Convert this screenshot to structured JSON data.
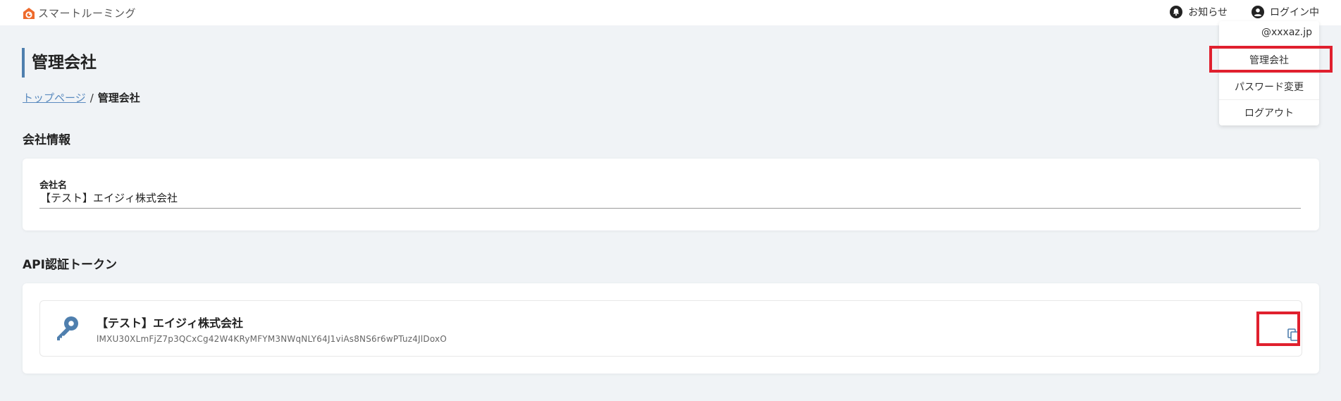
{
  "header": {
    "app_name": "スマートルーミング",
    "notifications_label": "お知らせ",
    "login_status_label": "ログイン中"
  },
  "user_menu": {
    "email": "@xxxaz.jp",
    "items": [
      {
        "label": "管理会社"
      },
      {
        "label": "パスワード変更"
      },
      {
        "label": "ログアウト"
      }
    ]
  },
  "page": {
    "title": "管理会社",
    "breadcrumb": {
      "home": "トップページ",
      "separator": "/",
      "current": "管理会社"
    }
  },
  "company_info": {
    "section_title": "会社情報",
    "company_name_label": "会社名",
    "company_name_value": "【テスト】エイジィ株式会社"
  },
  "api_token": {
    "section_title": "API認証トークン",
    "company_name": "【テスト】エイジィ株式会社",
    "token": "lMXU30XLmFjZ7p3QCxCg42W4KRyMFYM3NWqNLY64J1viAs8NS6r6wPTuz4JlDoxO"
  },
  "colors": {
    "accent": "#4f7fae",
    "highlight": "#e0202e",
    "logo": "#ee6a2c",
    "background": "#f0f3f6"
  }
}
